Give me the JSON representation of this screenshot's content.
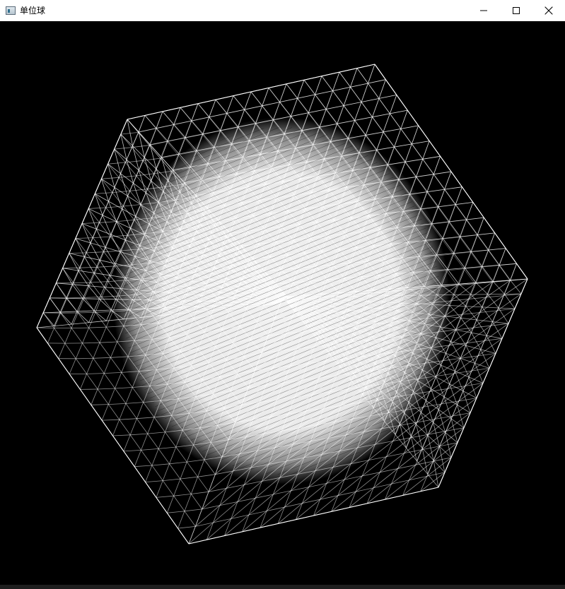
{
  "window": {
    "title": "单位球",
    "icon": "app-window-icon"
  },
  "titlebar": {
    "controls": [
      "minimize-icon",
      "maximize-icon",
      "close-icon"
    ]
  },
  "scene": {
    "background_color": "#000000",
    "line_color": "#ffffff",
    "description_type": "wireframe-subdivided-cube-with-point-sphere"
  }
}
